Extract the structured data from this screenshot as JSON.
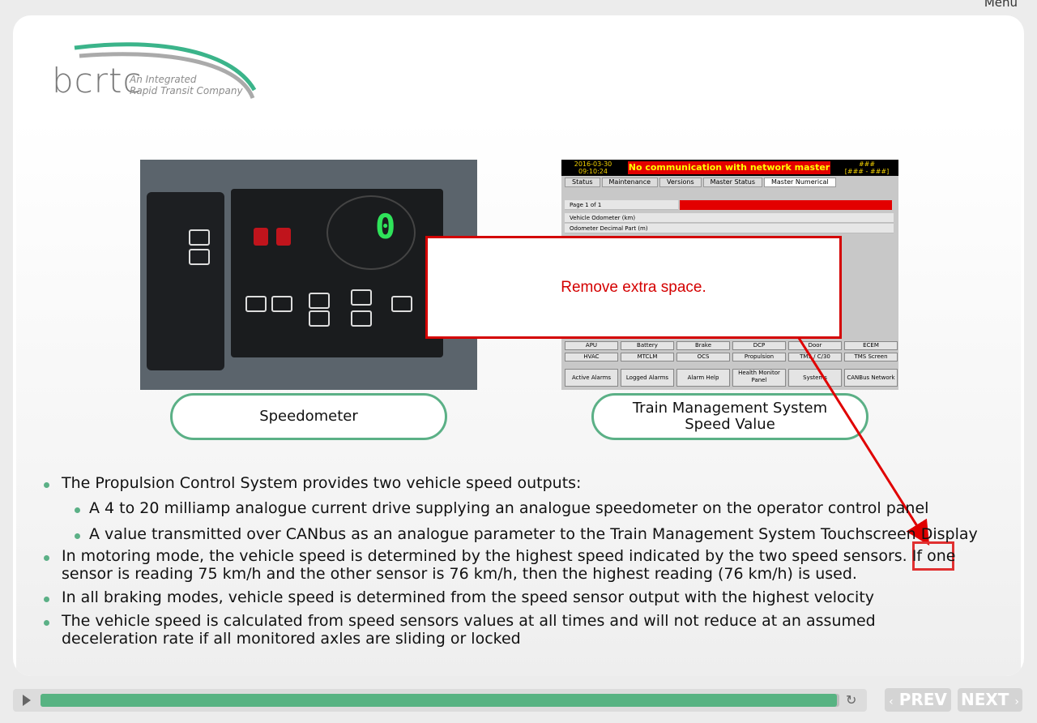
{
  "header": {
    "menu_label": "Menu"
  },
  "logo": {
    "name": "bcrtc",
    "tagline_line1": "An Integrated",
    "tagline_line2": "Rapid Transit Company"
  },
  "images": {
    "speedometer_digit": "0",
    "tms": {
      "date": "2016-03-30",
      "time": "09:10:24",
      "alert": "No communication with network master",
      "hash1": "###",
      "hash2": "[### - ###]",
      "tabs": [
        "Status",
        "Maintenance",
        "Versions",
        "Master Status",
        "Master Numerical"
      ],
      "page": "Page 1 of 1",
      "rows": [
        "Vehicle Odometer (km)",
        "Odometer Decimal Part (m)"
      ],
      "buttons_row1": [
        "APU",
        "Battery",
        "Brake",
        "DCP",
        "Door",
        "ECEM"
      ],
      "buttons_row2": [
        "HVAC",
        "MTCLM",
        "OCS",
        "Propulsion",
        "TMS / C/30",
        "TMS Screen"
      ],
      "buttons_row3": [
        "Active Alarms",
        "Logged Alarms",
        "Alarm Help",
        "Health Monitor Panel",
        "Systems",
        "CANBus Network"
      ]
    }
  },
  "captions": {
    "left": "Speedometer",
    "right": "Train Management System\nSpeed Value"
  },
  "callout": {
    "text": "Remove extra space."
  },
  "bullets": {
    "b1": "The Propulsion Control System provides two vehicle speed outputs:",
    "b1a": "A 4 to 20 milliamp analogue current drive supplying an analogue speedometer on the operator control panel",
    "b1b": "A value transmitted over CANbus as an analogue parameter to the Train Management System Touchscreen Display",
    "b2_line1": "In motoring mode, the vehicle speed is determined by the highest speed indicated by the two speed sensors.  If one",
    "b2_line2": "sensor is reading 75 km/h and the other sensor is 76 km/h, then the highest reading (76 km/h) is used.",
    "b3": "In all braking modes, vehicle speed is determined from the speed sensor output with the highest velocity",
    "b4_line1": "The vehicle speed is calculated from speed sensors values at all times and will not reduce at an assumed",
    "b4_line2": "deceleration rate if all monitored axles are sliding or locked"
  },
  "player": {
    "progress": 0.997,
    "prev_label": "PREV",
    "next_label": "NEXT",
    "colors": {
      "accent": "#57b382",
      "callout": "#d40000"
    }
  }
}
